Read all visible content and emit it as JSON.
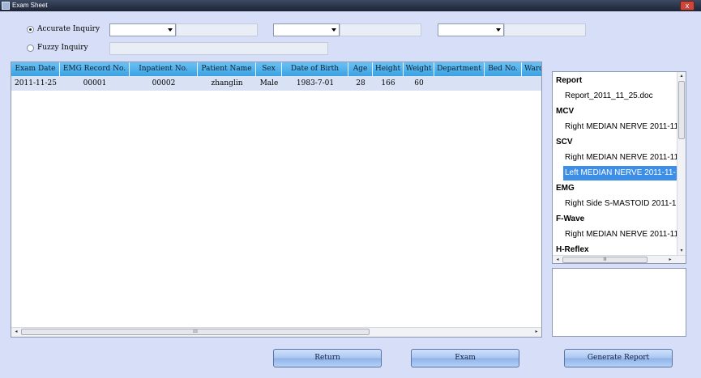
{
  "window": {
    "title": "Exam Sheet",
    "close_glyph": "x",
    "app_icon": "app-icon"
  },
  "search": {
    "accurate_label": "Accurate Inquiry",
    "fuzzy_label": "Fuzzy Inquiry",
    "accurate_selected": true,
    "combos": [
      "",
      "",
      ""
    ],
    "values": [
      "",
      "",
      ""
    ],
    "fuzzy_value": ""
  },
  "table": {
    "columns": [
      "Exam Date",
      "EMG Record No.",
      "Inpatient No.",
      "Patient Name",
      "Sex",
      "Date of Birth",
      "Age",
      "Height",
      "Weight",
      "Department",
      "Bed No.",
      "Ward"
    ],
    "rows": [
      [
        "2011-11-25",
        "00001",
        "00002",
        "zhanglin",
        "Male",
        "1983-7-01",
        "28",
        "166",
        "60",
        "",
        "",
        ""
      ]
    ],
    "selected_row": 0
  },
  "tree": {
    "items": [
      {
        "kind": "node",
        "label": "Report"
      },
      {
        "kind": "leaf",
        "label": "Report_2011_11_25.doc"
      },
      {
        "kind": "node",
        "label": "MCV"
      },
      {
        "kind": "leaf",
        "label": "Right MEDIAN NERVE 2011-11"
      },
      {
        "kind": "node",
        "label": "SCV"
      },
      {
        "kind": "leaf",
        "label": "Right MEDIAN NERVE 2011-11"
      },
      {
        "kind": "leaf",
        "label": "Left MEDIAN NERVE 2011-11-",
        "selected": true
      },
      {
        "kind": "node",
        "label": "EMG"
      },
      {
        "kind": "leaf",
        "label": "Right Side S-MASTOID 2011-1"
      },
      {
        "kind": "node",
        "label": "F-Wave"
      },
      {
        "kind": "leaf",
        "label": "Right MEDIAN NERVE 2011-11"
      },
      {
        "kind": "node",
        "label": "H-Reflex"
      }
    ]
  },
  "scroll": {
    "left": "◂",
    "right": "▸",
    "up": "▴",
    "down": "▾",
    "grip": "III"
  },
  "buttons": {
    "return": "Return",
    "exam": "Exam",
    "generate_report": "Generate Report"
  },
  "colors": {
    "header": "#3aa2e3",
    "selection": "#3d8ee6",
    "background": "#d6dff7"
  }
}
